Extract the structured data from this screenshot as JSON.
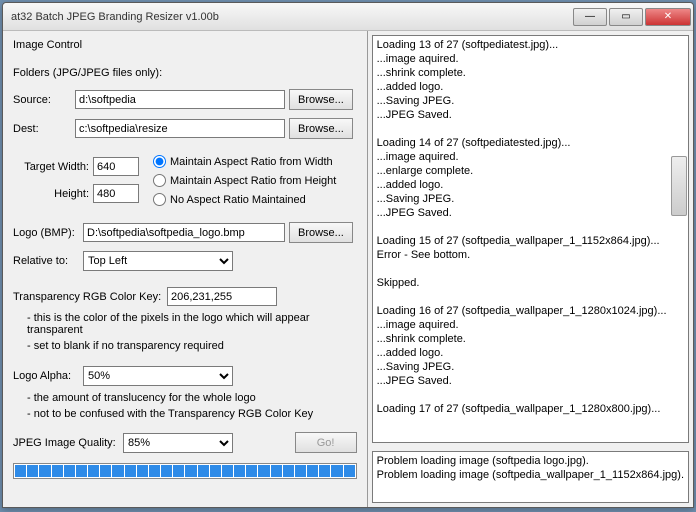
{
  "window": {
    "title": "at32 Batch JPEG Branding Resizer v1.00b"
  },
  "panel": {
    "title": "Image Control"
  },
  "folders": {
    "section_label": "Folders (JPG/JPEG files only):",
    "source_label": "Source:",
    "source_value": "d:\\softpedia",
    "dest_label": "Dest:",
    "dest_value": "c:\\softpedia\\resize",
    "browse_label": "Browse..."
  },
  "size": {
    "width_label": "Target Width:",
    "width_value": "640",
    "height_label": "Height:",
    "height_value": "480",
    "radio_width": "Maintain Aspect Ratio from Width",
    "radio_height": "Maintain Aspect Ratio from Height",
    "radio_none": "No Aspect Ratio Maintained"
  },
  "logo": {
    "label": "Logo (BMP):",
    "value": "D:\\softpedia\\softpedia_logo.bmp",
    "browse_label": "Browse...",
    "relative_label": "Relative to:",
    "relative_value": "Top Left"
  },
  "transparency": {
    "label": "Transparency RGB Color Key:",
    "value": "206,231,255",
    "hint1": "- this is the color of the pixels in the logo which will appear transparent",
    "hint2": "- set to blank if no transparency required"
  },
  "alpha": {
    "label": "Logo Alpha:",
    "value": "50%",
    "hint1": "- the amount of translucency for the whole logo",
    "hint2": "- not to be confused with the Transparency RGB Color Key"
  },
  "quality": {
    "label": "JPEG Image Quality:",
    "value": "85%"
  },
  "go_label": "Go!",
  "log_top": "Loading 13 of 27 (softpediatest.jpg)...\n...image aquired.\n...shrink complete.\n...added logo.\n...Saving JPEG.\n...JPEG Saved.\n\nLoading 14 of 27 (softpediatested.jpg)...\n...image aquired.\n...enlarge complete.\n...added logo.\n...Saving JPEG.\n...JPEG Saved.\n\nLoading 15 of 27 (softpedia_wallpaper_1_1152x864.jpg)...\nError - See bottom.\n\nSkipped.\n\nLoading 16 of 27 (softpedia_wallpaper_1_1280x1024.jpg)...\n...image aquired.\n...shrink complete.\n...added logo.\n...Saving JPEG.\n...JPEG Saved.\n\nLoading 17 of 27 (softpedia_wallpaper_1_1280x800.jpg)...\n",
  "log_bottom": "Problem loading image (softpedia logo.jpg).\nProblem loading image (softpedia_wallpaper_1_1152x864.jpg).",
  "progress_segments": 28
}
